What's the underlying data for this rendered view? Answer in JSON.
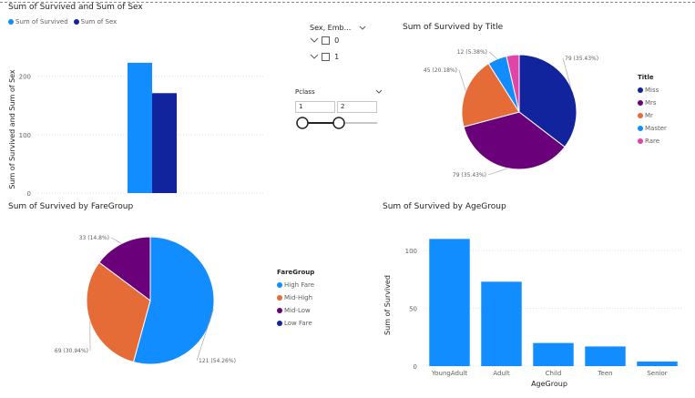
{
  "colors": {
    "blue": "#118dff",
    "navy": "#12239e",
    "purple": "#6b007b",
    "orange": "#e66c37",
    "magenta": "#e044a7",
    "grid": "#e1dfdd",
    "text": "#605e5c"
  },
  "combo": {
    "title": "Sum of Survived and Sum of Sex",
    "legend": [
      "Sum of Survived",
      "Sum of Sex"
    ],
    "ylabel": "Sum of Survived and Sum of Sex",
    "ticks": [
      "0",
      "100",
      "200"
    ],
    "chart_data": {
      "type": "bar",
      "categories": [
        ""
      ],
      "series": [
        {
          "name": "Sum of Survived",
          "values": [
            223
          ]
        },
        {
          "name": "Sum of Sex",
          "values": [
            171
          ]
        }
      ],
      "ylim": [
        0,
        240
      ]
    }
  },
  "slicer1": {
    "header": "Sex, Emb...",
    "items": [
      "0",
      "1"
    ]
  },
  "slicer2": {
    "header": "Pclass",
    "min": "1",
    "max": "2"
  },
  "title_pie": {
    "title": "Sum of Survived by Title",
    "legend_title": "Title",
    "chart_data": {
      "type": "pie",
      "categories": [
        "Miss",
        "Mrs",
        "Mr",
        "Master",
        "Rare"
      ],
      "values": [
        79,
        79,
        45,
        12,
        8
      ],
      "labels": [
        "79 (35.43%)",
        "79 (35.43%)",
        "45 (20.18%)",
        "12 (5.38%)",
        ""
      ]
    }
  },
  "fare_pie": {
    "title": "Sum of Survived by FareGroup",
    "legend_title": "FareGroup",
    "chart_data": {
      "type": "pie",
      "categories": [
        "High Fare",
        "Mid-High",
        "Mid-Low",
        "Low Fare"
      ],
      "values": [
        121,
        69,
        33,
        0
      ],
      "labels": [
        "121 (54.26%)",
        "69 (30.94%)",
        "33 (14.8%)",
        ""
      ]
    }
  },
  "age_bar": {
    "title": "Sum of Survived by AgeGroup",
    "xlabel": "AgeGroup",
    "ylabel": "Sum of Survived",
    "ticks": [
      "0",
      "50",
      "100"
    ],
    "chart_data": {
      "type": "bar",
      "categories": [
        "YoungAdult",
        "Adult",
        "Child",
        "Teen",
        "Senior"
      ],
      "values": [
        110,
        73,
        20,
        17,
        4
      ],
      "ylim": [
        0,
        115
      ]
    }
  }
}
